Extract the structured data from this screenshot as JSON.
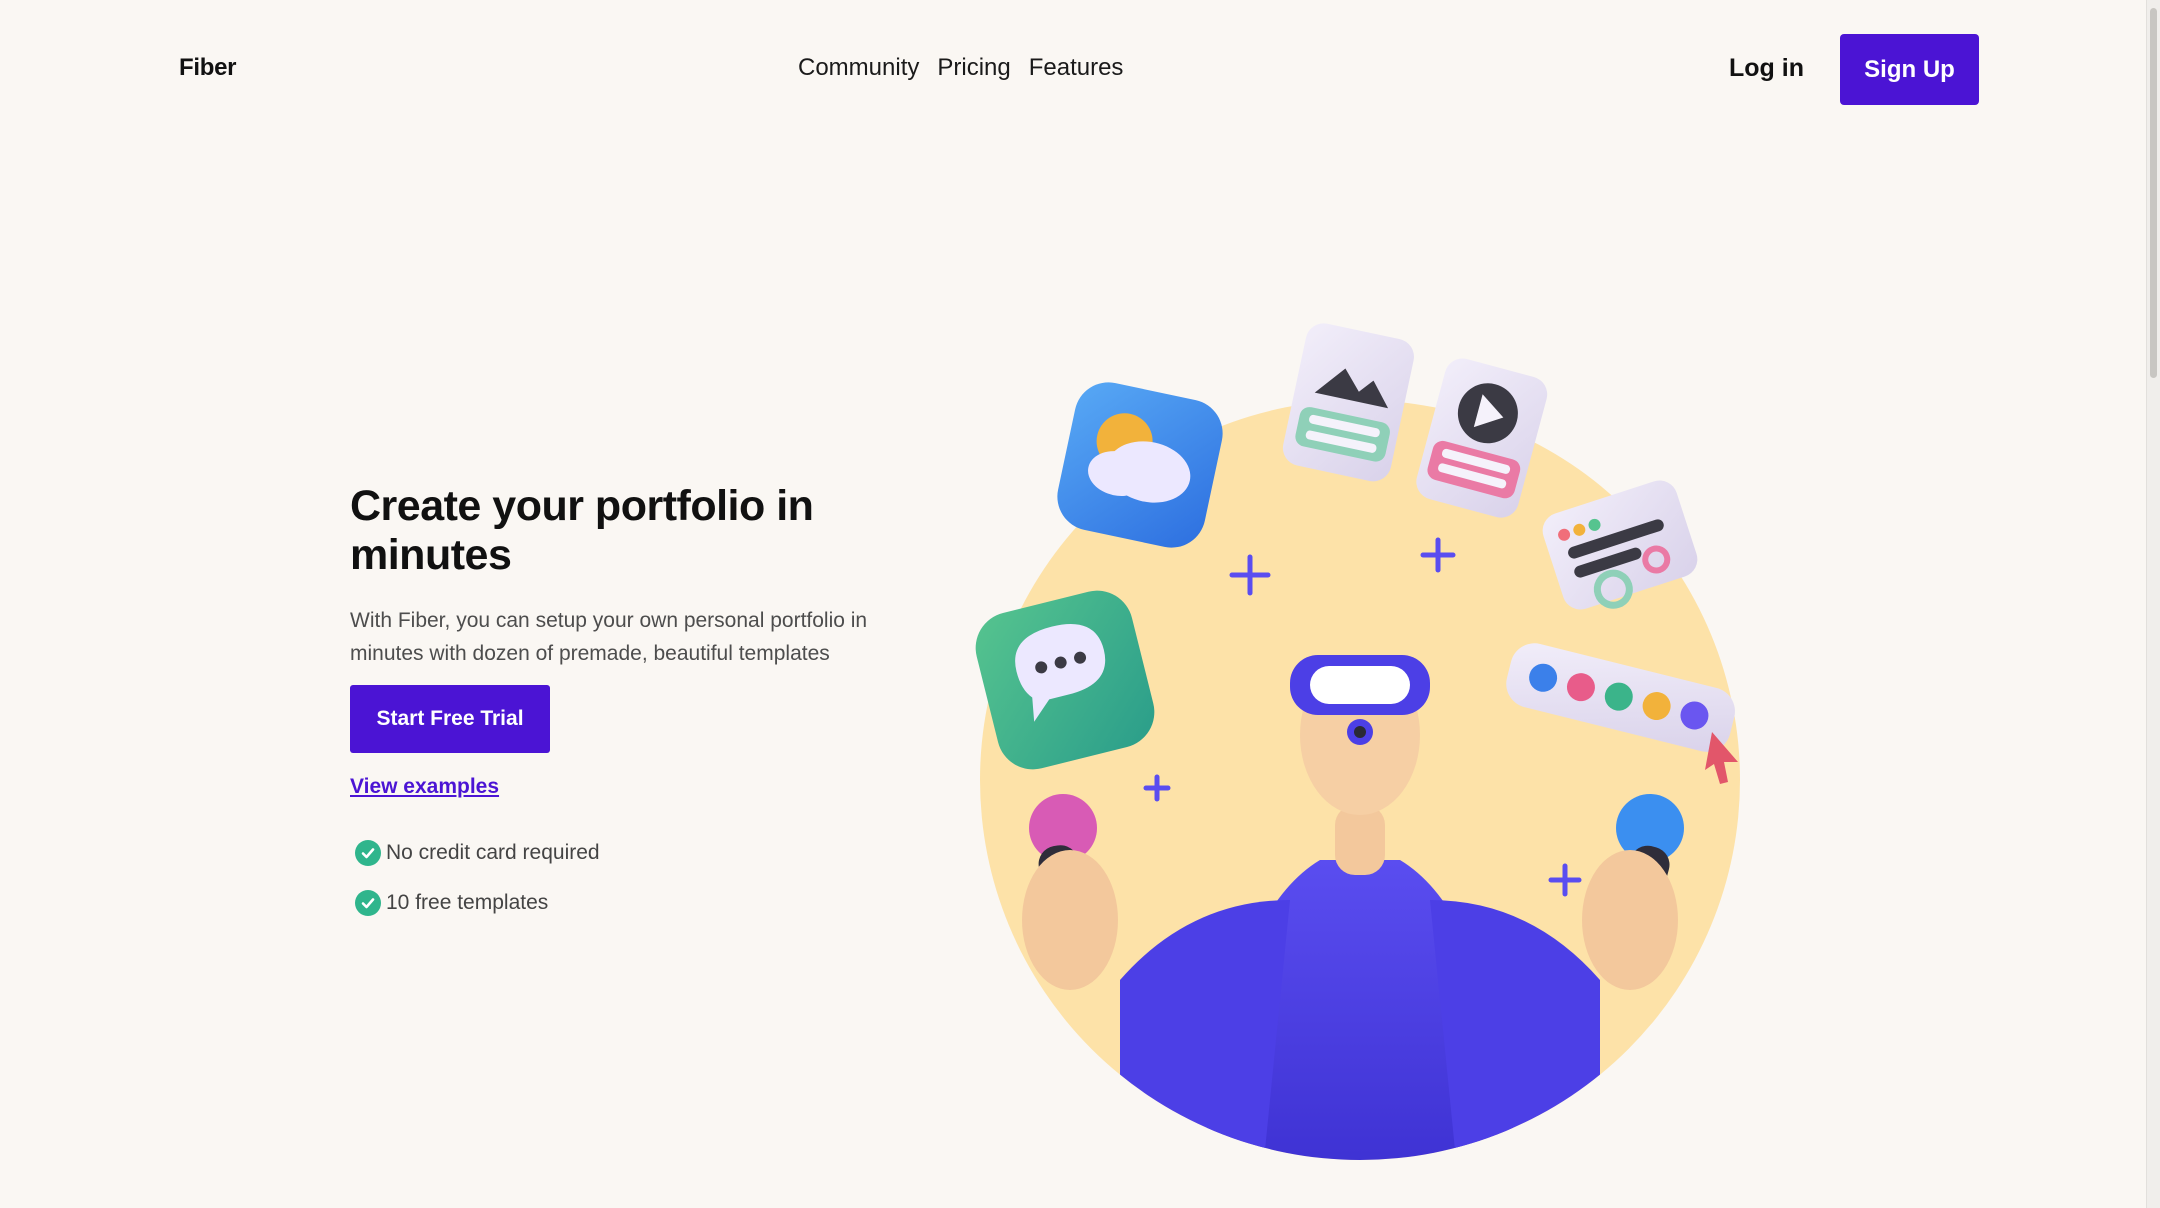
{
  "brand": "Fiber",
  "nav": {
    "links": [
      "Community",
      "Pricing",
      "Features"
    ],
    "login_label": "Log in",
    "signup_label": "Sign Up"
  },
  "hero": {
    "title": "Create your portfolio in minutes",
    "subtitle": "With Fiber, you can setup your own personal portfolio in minutes with dozen of premade, beautiful templates",
    "cta_label": "Start Free Trial",
    "examples_link": "View examples",
    "features": [
      "No credit card required",
      "10 free templates"
    ]
  },
  "illustration": {
    "icons": [
      "weather-app-icon",
      "image-card-icon",
      "play-card-icon",
      "chat-bubble-icon",
      "settings-card-icon",
      "color-palette-icon",
      "cursor-icon",
      "plus-icon"
    ]
  },
  "colors": {
    "accent": "#4b14d4",
    "background": "#faf7f3",
    "check": "#2fb58c",
    "circle": "#fde2a8"
  }
}
